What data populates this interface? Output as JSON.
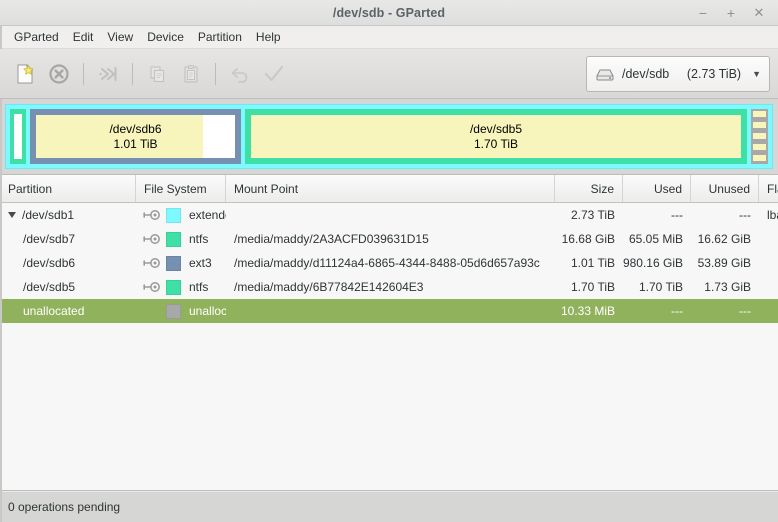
{
  "window": {
    "title": "/dev/sdb - GParted",
    "minimize_label": "−",
    "maximize_label": "+",
    "close_label": "✕"
  },
  "menubar": {
    "items": [
      {
        "label": "GParted"
      },
      {
        "label": "Edit"
      },
      {
        "label": "View"
      },
      {
        "label": "Device"
      },
      {
        "label": "Partition"
      },
      {
        "label": "Help"
      }
    ]
  },
  "toolbar": {
    "buttons": [
      {
        "icon": "new-partition-icon",
        "enabled": true
      },
      {
        "icon": "delete-partition-icon",
        "enabled": true
      },
      {
        "icon": "resize-move-icon",
        "enabled": false
      },
      {
        "icon": "copy-icon",
        "enabled": false
      },
      {
        "icon": "paste-icon",
        "enabled": false
      },
      {
        "icon": "undo-icon",
        "enabled": false
      },
      {
        "icon": "apply-icon",
        "enabled": false
      }
    ],
    "device_selector": {
      "icon": "hard-disk-icon",
      "device": "/dev/sdb",
      "size": "(2.73 TiB)",
      "arrow": "▼"
    }
  },
  "graphic": {
    "partitions": [
      {
        "name": "/dev/sdb7",
        "size": "",
        "label_visible": false
      },
      {
        "name": "/dev/sdb6",
        "size": "1.01 TiB",
        "label_visible": true
      },
      {
        "name": "/dev/sdb5",
        "size": "1.70 TiB",
        "label_visible": true
      }
    ]
  },
  "table": {
    "headers": [
      "Partition",
      "File System",
      "Mount Point",
      "Size",
      "Used",
      "Unused",
      "Flag"
    ],
    "rows": [
      {
        "partition": "/dev/sdb1",
        "filesystem": "extended",
        "fs_color": "#7df9ff",
        "mount_point": "",
        "size": "2.73 TiB",
        "used": "---",
        "unused": "---",
        "flags": "lba",
        "level": 0,
        "expanded": true,
        "mounted": true,
        "selected": false
      },
      {
        "partition": "/dev/sdb7",
        "filesystem": "ntfs",
        "fs_color": "#3fe0a5",
        "mount_point": "/media/maddy/2A3ACFD039631D15",
        "size": "16.68 GiB",
        "used": "65.05 MiB",
        "unused": "16.62 GiB",
        "flags": "",
        "level": 1,
        "expanded": false,
        "mounted": true,
        "selected": false
      },
      {
        "partition": "/dev/sdb6",
        "filesystem": "ext3",
        "fs_color": "#7590b0",
        "mount_point": "/media/maddy/d11124a4-6865-4344-8488-05d6d657a93c",
        "size": "1.01 TiB",
        "used": "980.16 GiB",
        "unused": "53.89 GiB",
        "flags": "",
        "level": 1,
        "expanded": false,
        "mounted": true,
        "selected": false
      },
      {
        "partition": "/dev/sdb5",
        "filesystem": "ntfs",
        "fs_color": "#3fe0a5",
        "mount_point": "/media/maddy/6B77842E142604E3",
        "size": "1.70 TiB",
        "used": "1.70 TiB",
        "unused": "1.73 GiB",
        "flags": "",
        "level": 1,
        "expanded": false,
        "mounted": true,
        "selected": false
      },
      {
        "partition": "unallocated",
        "filesystem": "unallocated",
        "fs_color": "#a8a8a8",
        "mount_point": "",
        "size": "10.33 MiB",
        "used": "---",
        "unused": "---",
        "flags": "",
        "level": 0,
        "expanded": false,
        "mounted": false,
        "selected": true
      }
    ]
  },
  "statusbar": {
    "text": "0 operations pending"
  }
}
